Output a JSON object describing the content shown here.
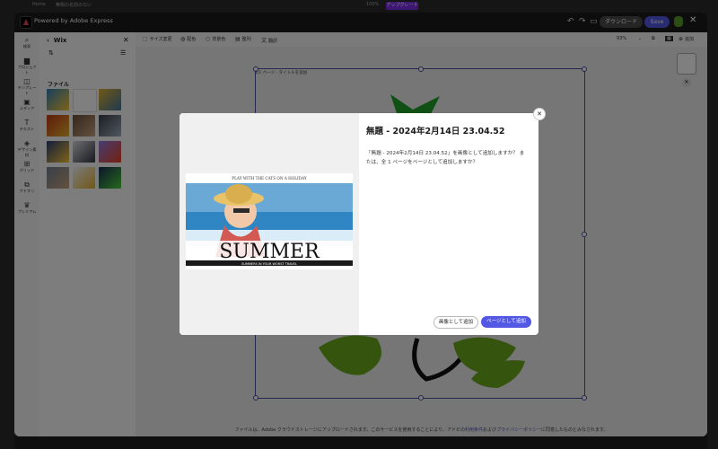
{
  "browser": {
    "tab_home": "Home",
    "tab_doc": "無題の名前のない",
    "zoom": "100%",
    "upgrade_label": "アップグレード"
  },
  "header": {
    "title": "Powered by Adobe Express",
    "download_label": "ダウンロード",
    "save_label": "Save"
  },
  "rail": {
    "items": [
      {
        "label": "検索",
        "icon": "search-icon"
      },
      {
        "label": "プロジェクト",
        "icon": "folder-icon"
      },
      {
        "label": "テンプレート",
        "icon": "template-icon"
      },
      {
        "label": "メディア",
        "icon": "media-icon"
      },
      {
        "label": "テキスト",
        "icon": "text-icon"
      },
      {
        "label": "デザイン素材",
        "icon": "shapes-icon"
      },
      {
        "label": "グリッド",
        "icon": "grid-icon"
      },
      {
        "label": "アドオン",
        "icon": "addon-icon"
      },
      {
        "label": "プレミアム",
        "icon": "crown-icon"
      }
    ]
  },
  "panel": {
    "title": "Wix",
    "section_label": "ファイル"
  },
  "toolbar": {
    "items": [
      "サイズ変更",
      "配色",
      "背景色",
      "整列",
      "翻訳"
    ],
    "zoom": "93%",
    "add_label": "追加"
  },
  "canvas": {
    "page_label": "1/1 ページ - タイトルを追加"
  },
  "footer": {
    "text_before": "ファイルは、Adobe クラウドストレージにアップロードされます。このサービスを使用することにより、アドビの",
    "link1": "利用条件",
    "text_mid": "および",
    "link2": "プライバシーポリシー",
    "text_after": "に同意したものとみなされます。"
  },
  "dialog": {
    "title": "無題 - 2024年2月14日 23.04.52",
    "body": "「無題 - 2024年2月14日 23.04.52」を画像として追加しますか？ または、全 1 ページをページとして追加しますか？",
    "add_image_label": "画像として追加",
    "add_page_label": "ページとして追加",
    "preview_top_text": "PLAY WITH THE CATS ON A HOLIDAY",
    "preview_big_text": "SUMMER",
    "preview_sub_text": "SUMMERS IN YOUR WORST TRAVEL"
  },
  "colors": {
    "accent": "#5258e4",
    "upgrade": "#7b2ee6",
    "selection": "#4e4e9e"
  }
}
